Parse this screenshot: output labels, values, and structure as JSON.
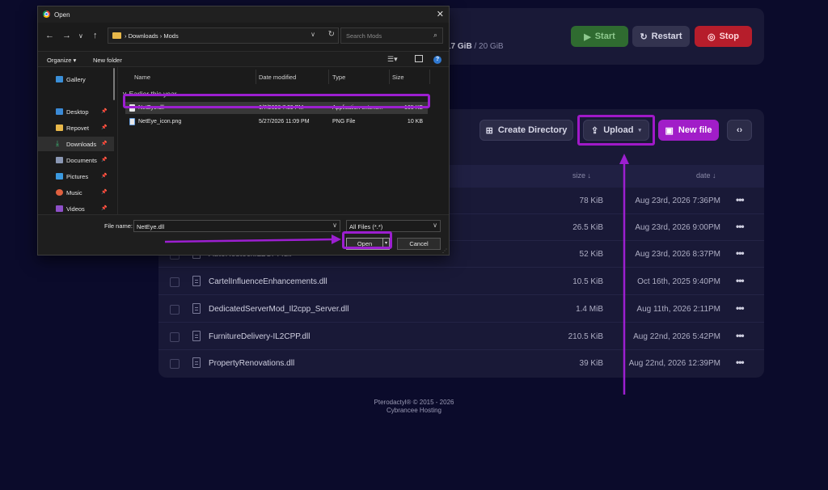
{
  "panel": {
    "memory_value": "17 GiB",
    "memory_total": "/ 20 GiB",
    "power": {
      "start": "Start",
      "restart": "Restart",
      "stop": "Stop"
    },
    "toolbar": {
      "create_directory": "Create Directory",
      "upload": "Upload",
      "new_file": "New file"
    },
    "columns": {
      "size": "size ↓",
      "date": "date ↓"
    },
    "files": [
      {
        "name": "",
        "size": "78 KiB",
        "date": "Aug 23rd, 2026 7:36PM"
      },
      {
        "name": "",
        "size": "26.5 KiB",
        "date": "Aug 23rd, 2026 9:00PM"
      },
      {
        "name": "AutoRestockIL2CPP.dll",
        "size": "52 KiB",
        "date": "Aug 23rd, 2026 8:37PM"
      },
      {
        "name": "CartelInfluenceEnhancements.dll",
        "size": "10.5 KiB",
        "date": "Oct 16th, 2025 9:40PM"
      },
      {
        "name": "DedicatedServerMod_Il2cpp_Server.dll",
        "size": "1.4 MiB",
        "date": "Aug 11th, 2026 2:11PM"
      },
      {
        "name": "FurnitureDelivery-IL2CPP.dll",
        "size": "210.5 KiB",
        "date": "Aug 22nd, 2026 5:42PM"
      },
      {
        "name": "PropertyRenovations.dll",
        "size": "39 KiB",
        "date": "Aug 22nd, 2026 12:39PM"
      }
    ],
    "footer": {
      "line1": "Pterodactyl® © 2015 - 2026",
      "line2": "Cybrancee Hosting"
    },
    "colors": {
      "background": "#0b0b2b",
      "card": "#191937",
      "accent_purple": "#a11dc8",
      "start_green": "#2f6b30",
      "stop_red": "#b61d2b"
    }
  },
  "dialog": {
    "title": "Open",
    "path": "›  Downloads  ›  Mods",
    "search_placeholder": "Search Mods",
    "organize": "Organize ▾",
    "new_folder": "New folder",
    "nav": [
      {
        "label": "Gallery",
        "icon": "gallery-icon",
        "pinned": false
      },
      {
        "label": "Desktop",
        "icon": "desktop-icon",
        "pinned": true
      },
      {
        "label": "Repovet",
        "icon": "folder-icon",
        "pinned": true
      },
      {
        "label": "Downloads",
        "icon": "download-icon",
        "pinned": true,
        "selected": true
      },
      {
        "label": "Documents",
        "icon": "documents-icon",
        "pinned": true
      },
      {
        "label": "Pictures",
        "icon": "pictures-icon",
        "pinned": true
      },
      {
        "label": "Music",
        "icon": "music-icon",
        "pinned": true
      },
      {
        "label": "Videos",
        "icon": "videos-icon",
        "pinned": true
      }
    ],
    "columns": {
      "name": "Name",
      "date": "Date modified",
      "type": "Type",
      "size": "Size"
    },
    "group": "Earlier this year",
    "files": [
      {
        "name": "NetEye.dll",
        "date": "6/7/2026 7:39 PM",
        "type": "Application extens...",
        "size": "165 KB",
        "selected": true
      },
      {
        "name": "NetEye_icon.png",
        "date": "5/27/2026 11:09 PM",
        "type": "PNG File",
        "size": "10 KB",
        "selected": false
      }
    ],
    "file_name_label": "File name:",
    "file_name_value": "NetEye.dll",
    "file_type": "All Files (*.*)",
    "open": "Open",
    "cancel": "Cancel"
  }
}
